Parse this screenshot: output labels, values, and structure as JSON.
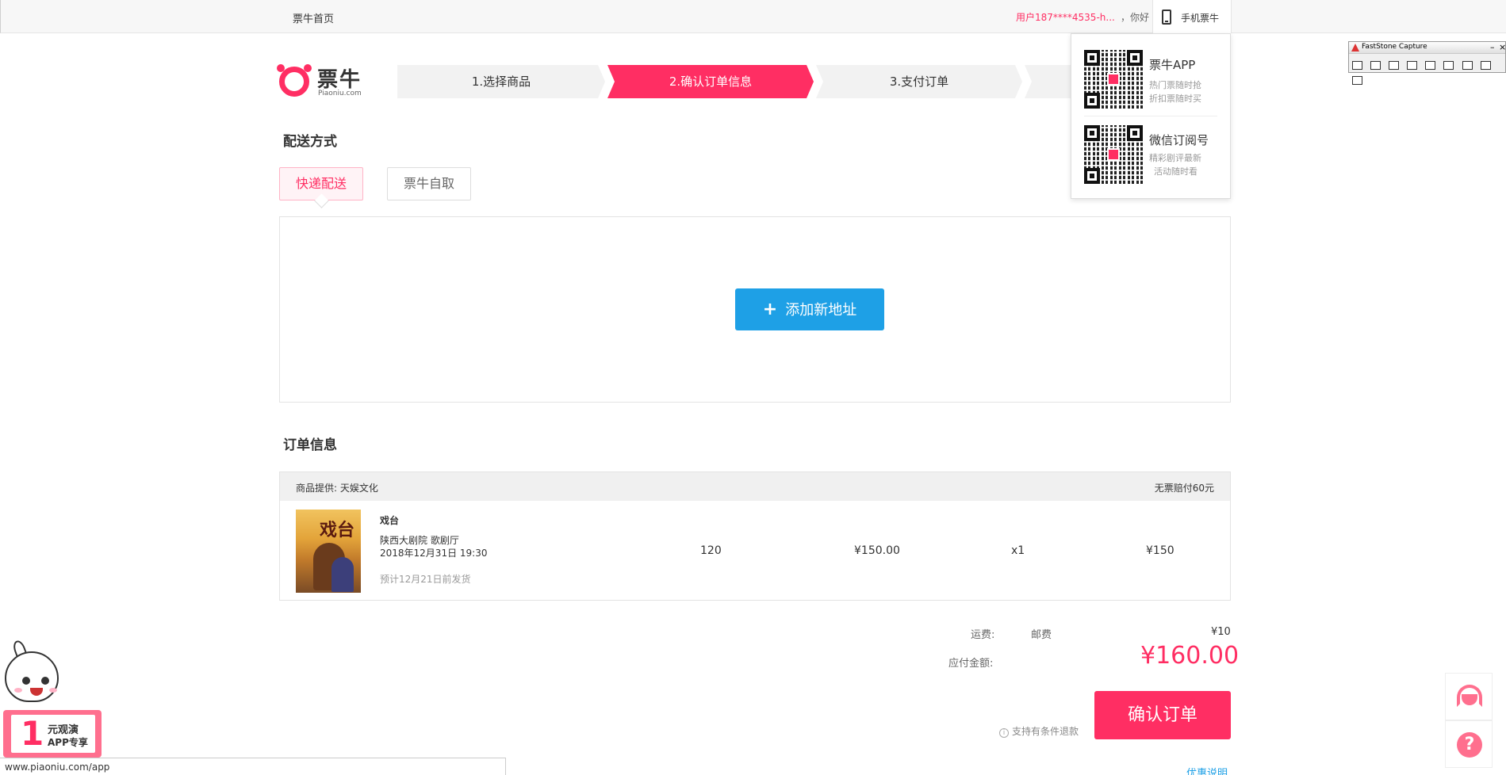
{
  "topbar": {
    "home": "票牛首页",
    "user": "用户187****4535-h...",
    "hello": "，你好",
    "mobile": "手机票牛"
  },
  "logo": {
    "name": "票牛",
    "domain": "Piaoniu.com"
  },
  "steps": [
    "1.选择商品",
    "2.确认订单信息",
    "3.支付订单",
    ""
  ],
  "popup": {
    "app": {
      "title": "票牛APP",
      "lines": [
        "热门票随时抢",
        "折扣票随时买"
      ]
    },
    "wechat": {
      "title": "微信订阅号",
      "lines": [
        "精彩剧评最新",
        "活动随时看"
      ]
    }
  },
  "delivery": {
    "heading": "配送方式",
    "tabs": [
      "快递配送",
      "票牛自取"
    ],
    "add_address": "添加新地址"
  },
  "order": {
    "heading": "订单信息",
    "supplier": "商品提供: 天娱文化",
    "compensation": "无票赔付60元",
    "item": {
      "name": "戏台",
      "venue": "陕西大剧院 歌剧厅",
      "datetime": "2018年12月31日 19:30",
      "ship_note": "预计12月21日前发货",
      "area": "120",
      "price": "¥150.00",
      "qty": "x1",
      "subtotal": "¥150"
    }
  },
  "totals": {
    "shipping_label": "运费:",
    "shipping_type": "邮费",
    "shipping_fee": "¥10",
    "due_label": "应付金额:",
    "due_amount": "¥160.00",
    "refund_note": "支持有条件退款",
    "confirm": "确认订单",
    "discount_info": "优惠说明"
  },
  "faststone": {
    "title": "FastStone Capture"
  },
  "promo": {
    "number": "1",
    "line1": "元观演",
    "line2": "APP专享"
  },
  "status_url": "www.piaoniu.com/app",
  "colors": {
    "brand": "#ff2e63",
    "blue": "#1ea0e6"
  }
}
